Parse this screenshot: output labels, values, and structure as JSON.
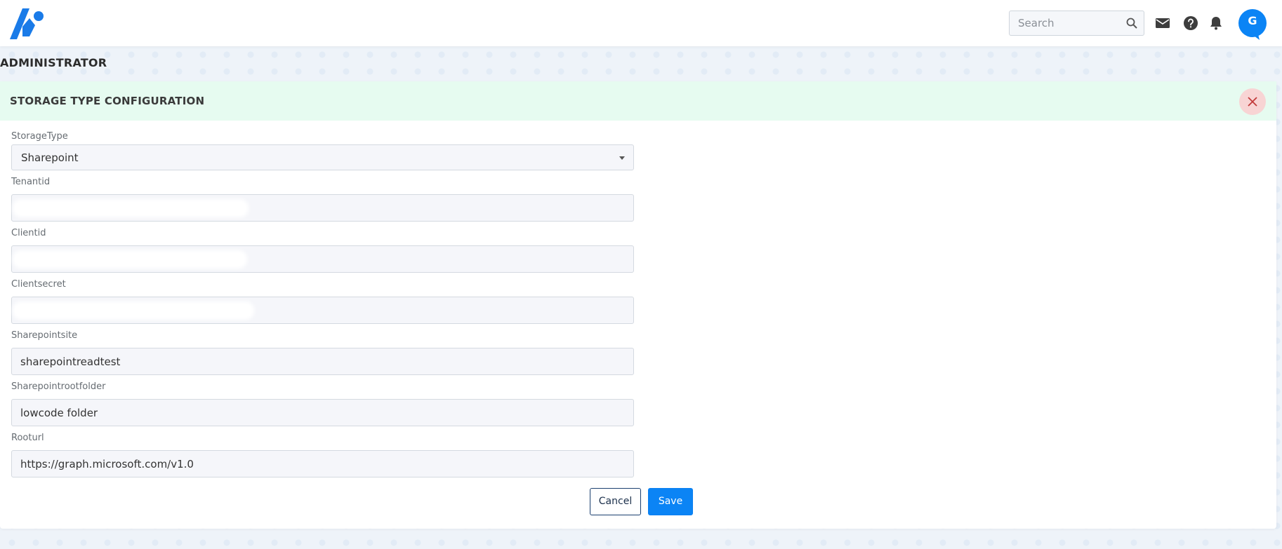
{
  "header": {
    "search": {
      "placeholder": "Search",
      "value": ""
    },
    "icons": [
      "mail-icon",
      "help-icon",
      "bell-icon"
    ],
    "avatar_letter": "G"
  },
  "page": {
    "title": "ADMINISTRATOR"
  },
  "panel": {
    "title": "STORAGE TYPE CONFIGURATION",
    "fields": {
      "storage_type": {
        "label": "StorageType",
        "value": "Sharepoint"
      },
      "tenant_id": {
        "label": "Tenantid",
        "value": ""
      },
      "client_id": {
        "label": "Clientid",
        "value": ""
      },
      "client_secret": {
        "label": "Clientsecret",
        "value": ""
      },
      "sharepoint_site": {
        "label": "Sharepointsite",
        "value": "sharepointreadtest"
      },
      "sharepoint_root_folder": {
        "label": "Sharepointrootfolder",
        "value": "lowcode folder"
      },
      "root_url": {
        "label": "Rooturl",
        "value": "https://graph.microsoft.com/v1.0"
      }
    },
    "buttons": {
      "cancel": "Cancel",
      "save": "Save"
    }
  },
  "colors": {
    "primary": "#0b84f5",
    "panel_header_bg": "#e6fbf0",
    "close_bg": "#f8d4d4",
    "logo": "#1a7be8"
  }
}
